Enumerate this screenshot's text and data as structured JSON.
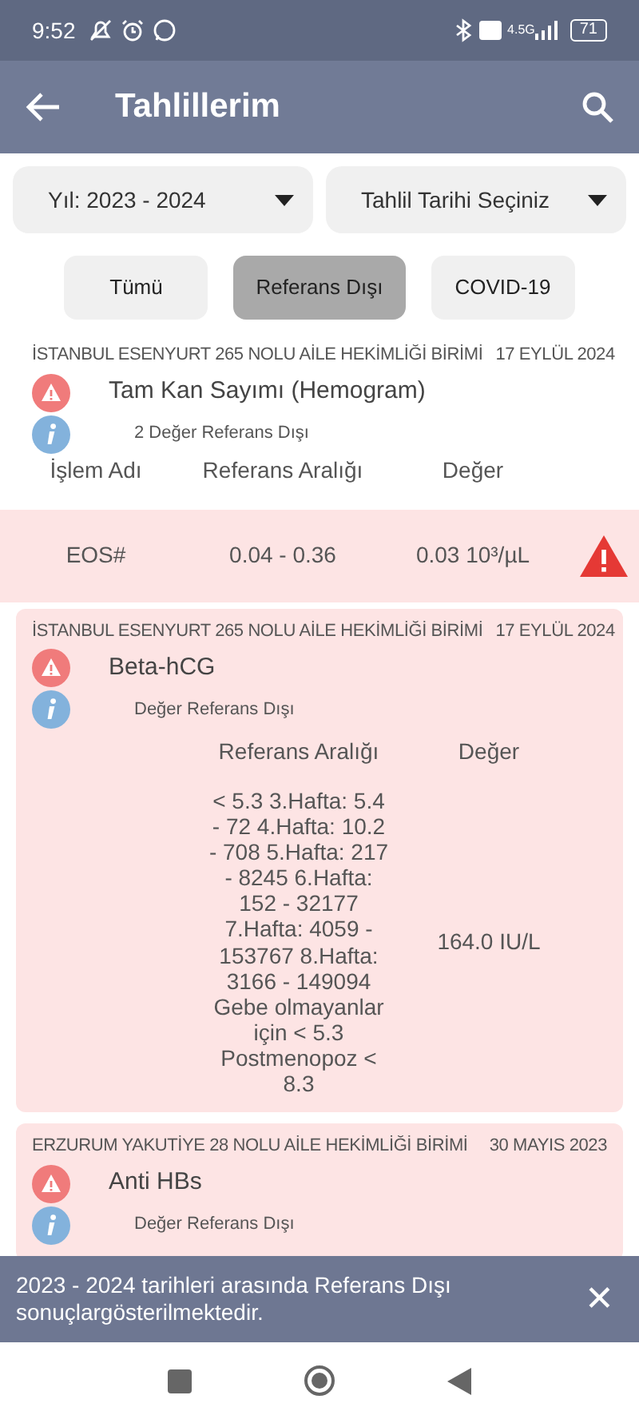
{
  "status_bar": {
    "time": "9:52",
    "network": "4.5G",
    "battery": "71"
  },
  "app_bar": {
    "title": "Tahlillerim"
  },
  "filters": [
    {
      "kind": "dropdown",
      "label": "Yıl: 2023 - 2024"
    },
    {
      "kind": "dropdown",
      "label": "Tahlil Tarihi Seçiniz"
    }
  ],
  "chips": [
    {
      "label": "Tümü",
      "selected": false
    },
    {
      "label": "Referans Dışı",
      "selected": true
    },
    {
      "label": "COVID-19",
      "selected": false
    }
  ],
  "results": [
    {
      "kind": "plain",
      "institution": "İSTANBUL ESENYURT 265 NOLU AİLE HEKİMLİĞİ BİRİMİ",
      "date": "17 EYLÜL 2024",
      "test": "Tam Kan Sayımı (Hemogram)",
      "note": "2 Değer Referans Dışı",
      "columns": {
        "name": "İşlem Adı",
        "range": "Referans Aralığı",
        "value": "Değer"
      },
      "rows": [
        {
          "name": "EOS#",
          "range": "0.04 - 0.36",
          "value": "0.03 10³/µL",
          "alert": true
        }
      ]
    },
    {
      "kind": "card",
      "institution": "İSTANBUL ESENYURT 265 NOLU AİLE HEKİMLİĞİ BİRİMİ",
      "date": "17 EYLÜL 2024",
      "test": "Beta-hCG",
      "note": "Değer Referans Dışı",
      "columns": {
        "range": "Referans Aralığı",
        "value": "Değer"
      },
      "rows": [
        {
          "range": "< 5.3  3.Hafta: 5.4 - 72  4.Hafta: 10.2 - 708  5.Hafta: 217 - 8245 6.Hafta: 152 - 32177  7.Hafta: 4059 - 153767 8.Hafta: 3166 - 149094  Gebe olmayanlar için < 5.3 Postmenopoz < 8.3",
          "value": "164.0 IU/L",
          "alert": false
        }
      ]
    },
    {
      "kind": "card",
      "institution": "ERZURUM YAKUTİYE 28 NOLU AİLE HEKİMLİĞİ BİRİMİ",
      "date": "30 MAYIS 2023",
      "test": "Anti HBs",
      "note": "Değer Referans Dışı"
    }
  ],
  "snackbar": {
    "message": "2023 - 2024 tarihleri arasında Referans Dışı sonuçlargösterilmektedir.",
    "close": "✕"
  }
}
